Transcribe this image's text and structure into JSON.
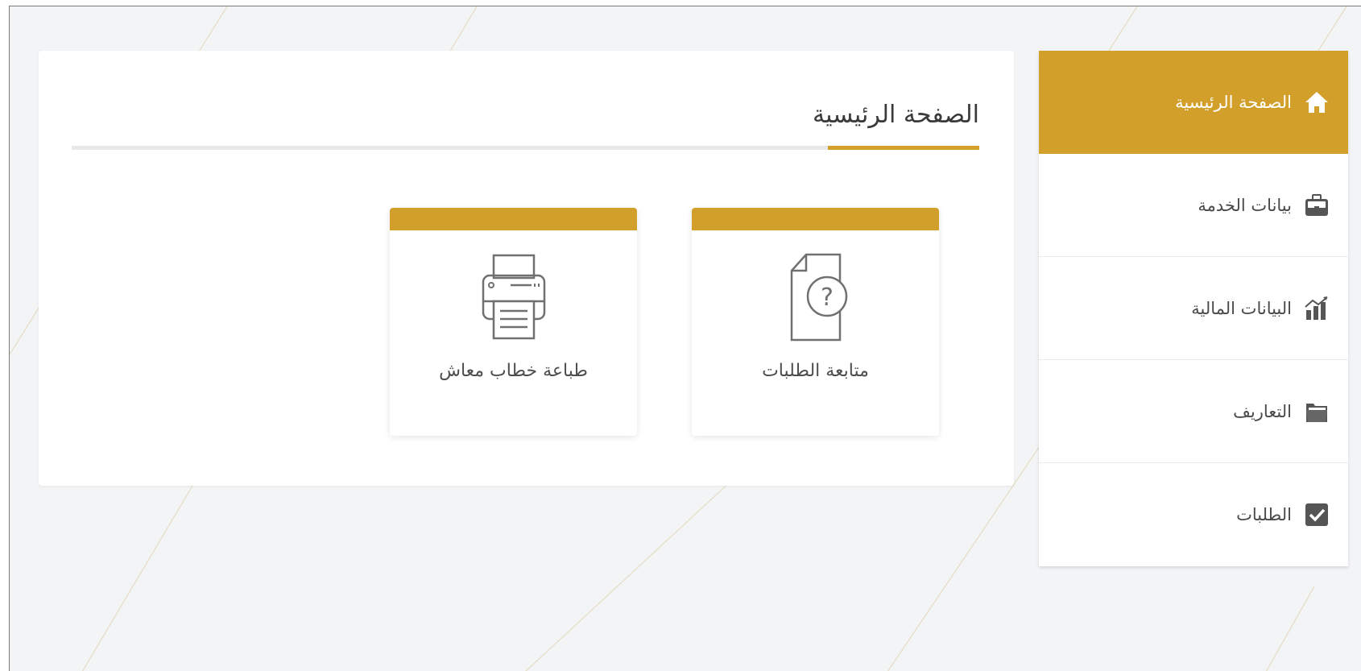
{
  "colors": {
    "accent": "#d39f2b",
    "background": "#f3f4f6",
    "card": "#ffffff",
    "text": "#4a4a4a"
  },
  "sidebar": {
    "items": [
      {
        "label": "الصفحة الرئيسية",
        "icon": "home-icon",
        "active": true
      },
      {
        "label": "بيانات الخدمة",
        "icon": "briefcase-icon",
        "active": false
      },
      {
        "label": "البيانات المالية",
        "icon": "bar-chart-icon",
        "active": false
      },
      {
        "label": "التعاريف",
        "icon": "folder-icon",
        "active": false
      },
      {
        "label": "الطلبات",
        "icon": "checkbox-icon",
        "active": false
      }
    ]
  },
  "main": {
    "title": "الصفحة الرئيسية",
    "tiles": [
      {
        "label": "متابعة الطلبات",
        "icon": "document-question-icon"
      },
      {
        "label": "طباعة خطاب معاش",
        "icon": "printer-icon"
      }
    ]
  }
}
